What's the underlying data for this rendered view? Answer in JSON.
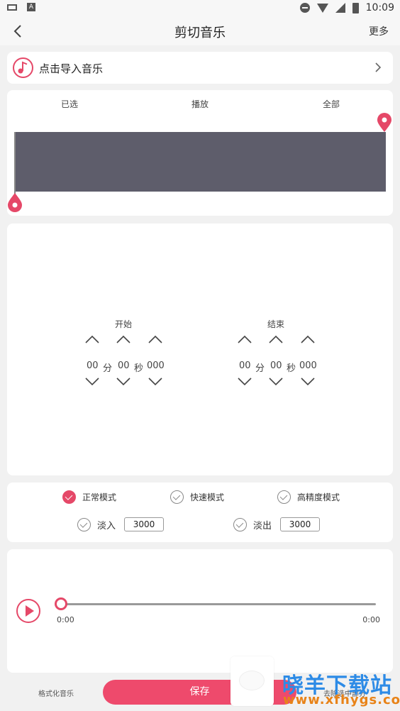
{
  "status_bar": {
    "time": "10:09"
  },
  "header": {
    "title": "剪切音乐",
    "more_label": "更多"
  },
  "import": {
    "label": "点击导入音乐"
  },
  "waveform": {
    "tabs": [
      "已选",
      "播放",
      "全部"
    ]
  },
  "start": {
    "title": "开始",
    "min": "00",
    "min_unit": "分",
    "sec": "00",
    "sec_unit": "秒",
    "ms": "000"
  },
  "end": {
    "title": "结束",
    "min": "00",
    "min_unit": "分",
    "sec": "00",
    "sec_unit": "秒",
    "ms": "000"
  },
  "modes": {
    "normal": "正常模式",
    "fast": "快速模式",
    "precise": "高精度模式"
  },
  "fade": {
    "in_label": "淡入",
    "in_value": "3000",
    "out_label": "淡出",
    "out_value": "3000"
  },
  "player": {
    "current": "0:00",
    "total": "0:00",
    "progress": 0
  },
  "bottom": {
    "format_label": "格式化音乐",
    "save_label": "保存",
    "clear_label": "去除选中部分"
  },
  "watermark": {
    "title": "晓羊下载站",
    "url": "www.xfhygs.com"
  },
  "colors": {
    "accent": "#ee4a6c",
    "wave": "#5e5d6b"
  }
}
